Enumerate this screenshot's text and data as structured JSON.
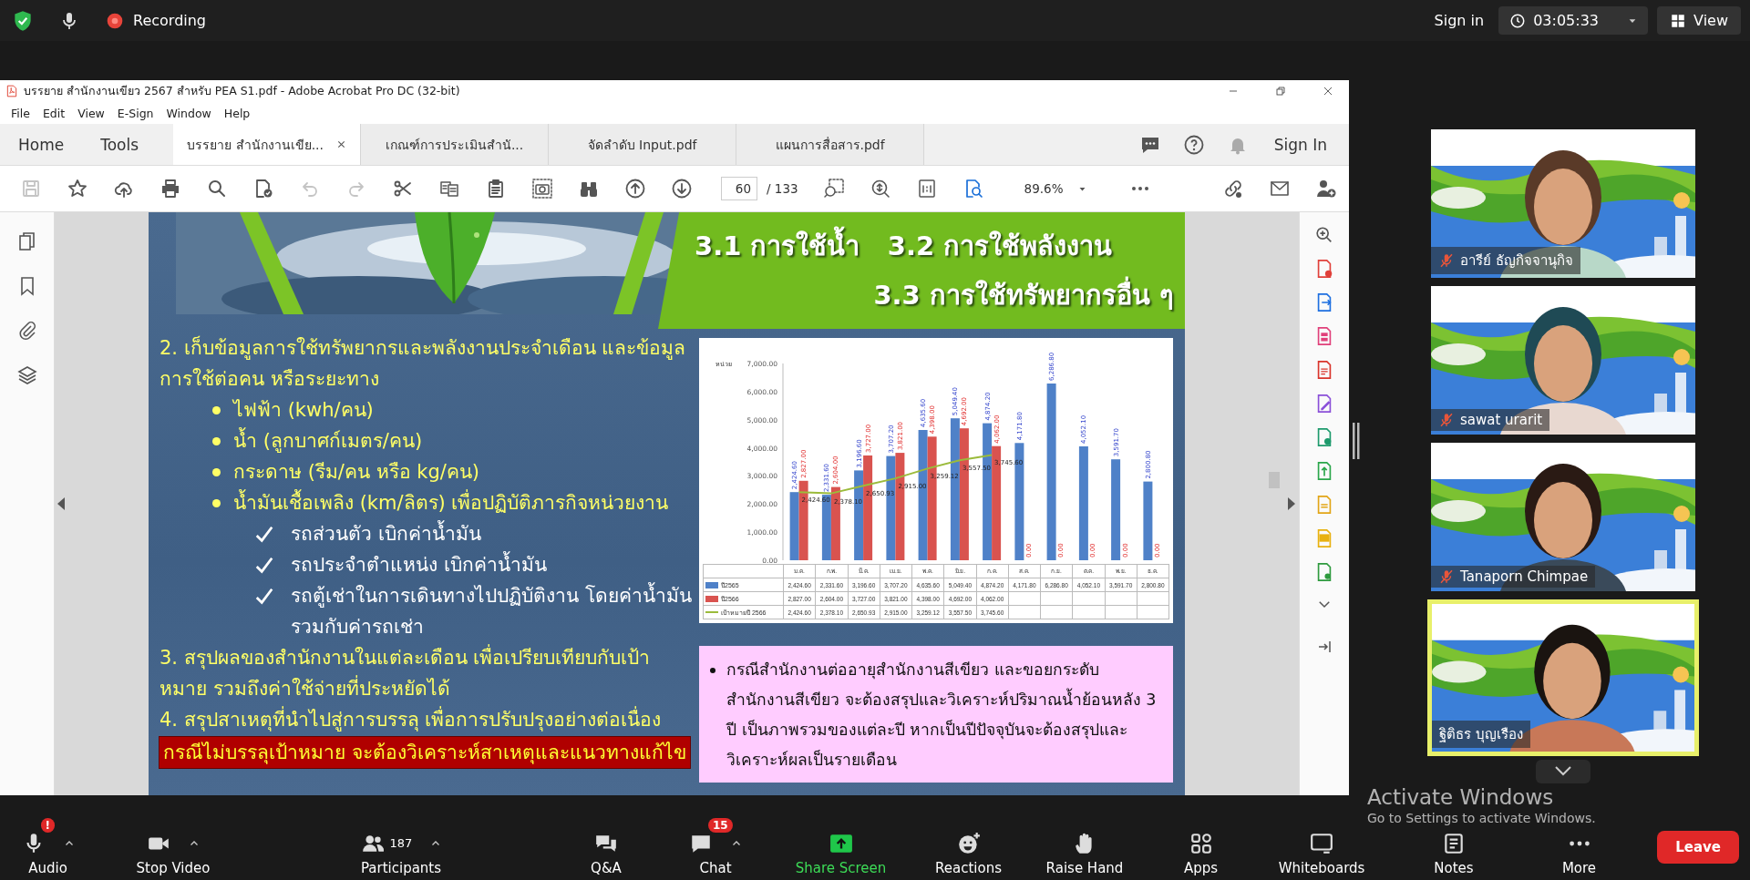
{
  "top_bar": {
    "recording": "Recording",
    "sign_in": "Sign in",
    "timer": "03:05:33",
    "view": "View"
  },
  "acrobat": {
    "title": "บรรยาย สำนักงานเขียว 2567 สำหรับ PEA S1.pdf - Adobe Acrobat Pro DC (32-bit)",
    "menu": [
      "File",
      "Edit",
      "View",
      "E-Sign",
      "Window",
      "Help"
    ],
    "nav": [
      "Home",
      "Tools"
    ],
    "tabs": [
      {
        "label": "บรรยาย สำนักงานเขีย...",
        "selected": true
      },
      {
        "label": "เกณฑ์การประเมินสำนั...",
        "selected": false
      },
      {
        "label": "จัดลำดับ Input.pdf",
        "selected": false
      },
      {
        "label": "แผนการสื่อสาร.pdf",
        "selected": false
      }
    ],
    "sign_in": "Sign In",
    "toolbar": [
      {
        "disabled": true
      },
      {
        "disabled": false
      },
      {
        "disabled": false
      },
      {
        "disabled": false
      },
      {
        "disabled": false
      },
      {
        "disabled": false
      },
      {
        "disabled": true
      },
      {
        "disabled": true
      },
      {
        "disabled": false
      },
      {
        "disabled": false
      },
      {
        "disabled": false
      },
      {
        "disabled": false
      },
      {
        "disabled": false
      },
      {
        "disabled": false
      },
      {
        "disabled": false
      }
    ],
    "page_number": "60",
    "page_total": "/ 133",
    "zoom": "89.6%"
  },
  "slide": {
    "heading_lines": [
      "3.1 การใช้น้ำ   3.2 การใช้พลังงาน",
      "3.3 การใช้ทรัพยากรอื่น ๆ"
    ],
    "items": [
      {
        "kind": "numbered",
        "text": "2. เก็บข้อมูลการใช้ทรัพยากรและพลังงานประจำเดือน และข้อมูลการใช้ต่อคน หรือระยะทาง"
      },
      {
        "kind": "bullet",
        "text": "ไฟฟ้า (kwh/คน)"
      },
      {
        "kind": "bullet",
        "text": "น้ำ (ลูกบาศก์เมตร/คน)"
      },
      {
        "kind": "bullet",
        "text": "กระดาษ (รีม/คน หรือ kg/คน)"
      },
      {
        "kind": "bullet",
        "text": "น้ำมันเชื้อเพลิง (km/ลิตร) เพื่อปฏิบัติภารกิจหน่วยงาน"
      },
      {
        "kind": "check",
        "text": "รถส่วนตัว เบิกค่าน้ำมัน"
      },
      {
        "kind": "check",
        "text": "รถประจำตำแหน่ง เบิกค่าน้ำมัน"
      },
      {
        "kind": "check",
        "text": "รถตู้เช่าในการเดินทางไปปฏิบัติงาน โดยค่าน้ำมันรวมกับค่ารถเช่า"
      },
      {
        "kind": "numbered",
        "text": "3. สรุปผลของสำนักงานในแต่ละเดือน เพื่อเปรียบเทียบกับเป้าหมาย รวมถึงค่าใช้จ่ายที่ประหยัดได้"
      },
      {
        "kind": "numbered",
        "text": "4. สรุปสาเหตุที่นำไปสู่การบรรลุ เพื่อการปรับปรุงอย่างต่อเนื่อง"
      },
      {
        "kind": "highlight",
        "text": "กรณีไม่บรรลุเป้าหมาย จะต้องวิเคราะห์สาเหตุและแนวทางแก้ไข"
      }
    ],
    "chart_data": {
      "type": "bar",
      "ylabel": "หน่วย",
      "categories": [
        "ม.ค.",
        "ก.พ.",
        "มี.ค.",
        "เม.ย.",
        "พ.ค.",
        "มิ.ย.",
        "ก.ค.",
        "ส.ค.",
        "ก.ย.",
        "ต.ค.",
        "พ.ย.",
        "ธ.ค."
      ],
      "ylim": [
        0,
        7000
      ],
      "yticks": [
        {
          "value": 0,
          "label": "0.00"
        },
        {
          "value": 1000,
          "label": "1,000.00"
        },
        {
          "value": 2000,
          "label": "2,000.00"
        },
        {
          "value": 3000,
          "label": "3,000.00"
        },
        {
          "value": 4000,
          "label": "4,000.00"
        },
        {
          "value": 5000,
          "label": "5,000.00"
        },
        {
          "value": 6000,
          "label": "6,000.00"
        },
        {
          "value": 7000,
          "label": "7,000.00"
        }
      ],
      "legend": "bottom left",
      "series": [
        {
          "name": "ปี2565",
          "color": "#4f81c8",
          "type": "bar",
          "values": [
            2424.6,
            2331.6,
            3196.6,
            3707.2,
            4635.6,
            5049.4,
            4874.2,
            4171.8,
            6286.8,
            4052.1,
            3591.7,
            2800.8
          ],
          "value_labels": [
            "2,424.60",
            "2,331.60",
            "3,196.60",
            "3,707.20",
            "4,635.60",
            "5,049.40",
            "4,874.20",
            "4,171.80",
            "6,286.80",
            "4,052.10",
            "3,591.70",
            "2,800.80"
          ]
        },
        {
          "name": "ปี2566",
          "color": "#d9534f",
          "type": "bar",
          "values": [
            2827,
            2604,
            3727,
            3821,
            4398,
            4692,
            4062,
            0,
            0,
            0,
            0,
            0
          ],
          "value_labels": [
            "2,827.00",
            "2,604.00",
            "3,727.00",
            "3,821.00",
            "4,398.00",
            "4,692.00",
            "4,062.00",
            "0.00",
            "0.00",
            "0.00",
            "0.00",
            "0.00"
          ]
        },
        {
          "name": "เป้าหมายปี 2566",
          "color": "#9bbb3b",
          "type": "line",
          "values": [
            2424.6,
            2378.1,
            2650.93,
            2915,
            3259.12,
            3557.5,
            3745.6,
            null,
            null,
            null,
            null,
            null
          ],
          "value_labels": [
            "2,424.60",
            "2,378.10",
            "2,650.93",
            "2,915.00",
            "3,259.12",
            "3,557.50",
            "3,745.60",
            null,
            null,
            null,
            null,
            null
          ]
        }
      ]
    },
    "data_table": [
      [
        "2,424.60",
        "2,331.60",
        "3,196.60",
        "3,707.20",
        "4,635.60",
        "5,049.40",
        "4,874.20",
        "4,171.80",
        "6,286.80",
        "4,052.10",
        "3,591.70",
        "2,800.80"
      ],
      [
        "2,827.00",
        "2,604.00",
        "3,727.00",
        "3,821.00",
        "4,398.00",
        "4,692.00",
        "4,062.00"
      ],
      [
        "2,424.60",
        "2,378.10",
        "2,650.93",
        "2,915.00",
        "3,259.12",
        "3,557.50",
        "3,745.60"
      ]
    ],
    "note": "กรณีสำนักงานต่ออายุสำนักงานสีเขียว และขอยกระดับสำนักงานสีเขียว จะต้องสรุปและวิเคราะห์ปริมาณน้ำย้อนหลัง 3 ปี เป็นภาพรวมของแต่ละปี หากเป็นปีปัจจุบันจะต้องสรุปและวิเคราะห์ผลเป็นรายเดือน"
  },
  "participants": [
    {
      "name": "อารีย์ ธัญกิจจานุกิจ",
      "muted": true,
      "speaking": false
    },
    {
      "name": "sawat urarit",
      "muted": true,
      "speaking": false
    },
    {
      "name": "Tanaporn Chimpae",
      "muted": true,
      "speaking": false
    },
    {
      "name": "ฐิติธร บุญเรือง",
      "muted": false,
      "speaking": true
    }
  ],
  "bottom_bar": {
    "items": [
      {
        "kind": "audio",
        "label": "Audio",
        "badge": "!",
        "caret": true,
        "highlighted": false
      },
      {
        "kind": "video",
        "label": "Stop Video",
        "caret": true,
        "highlighted": false
      },
      {
        "kind": "participants",
        "label": "Participants",
        "count": "187",
        "caret": true,
        "highlighted": false
      },
      {
        "kind": "qa",
        "label": "Q&A",
        "caret": false,
        "highlighted": false
      },
      {
        "kind": "chat",
        "label": "Chat",
        "badge": "15",
        "caret": true,
        "highlighted": false
      },
      {
        "kind": "share",
        "label": "Share Screen",
        "caret": false,
        "highlighted": true
      },
      {
        "kind": "reactions",
        "label": "Reactions",
        "caret": false,
        "highlighted": false
      },
      {
        "kind": "hand",
        "label": "Raise Hand",
        "caret": false,
        "highlighted": false
      },
      {
        "kind": "apps",
        "label": "Apps",
        "caret": false,
        "highlighted": false
      },
      {
        "kind": "whiteboard",
        "label": "Whiteboards",
        "caret": false,
        "highlighted": false
      },
      {
        "kind": "notes",
        "label": "Notes",
        "caret": false,
        "highlighted": false
      },
      {
        "kind": "more",
        "label": "More",
        "caret": false,
        "highlighted": false
      }
    ],
    "leave": "Leave"
  },
  "windows_notice": {
    "title": "Activate Windows",
    "text": "Go to Settings to activate Windows."
  }
}
